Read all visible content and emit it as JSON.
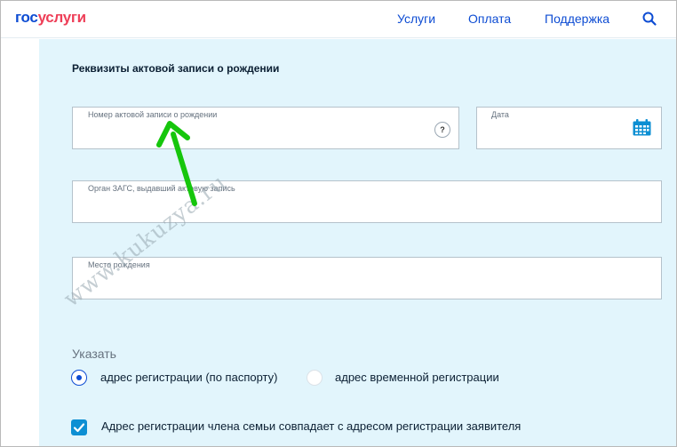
{
  "header": {
    "logo_part1": "гос",
    "logo_part2": "услуги",
    "nav": [
      "Услуги",
      "Оплата",
      "Поддержка"
    ],
    "search_icon": "search-icon"
  },
  "section": {
    "title": "Реквизиты актовой записи о рождении"
  },
  "fields": {
    "record_number": {
      "label": "Номер актовой записи о рождении",
      "value": ""
    },
    "date": {
      "label": "Дата",
      "value": ""
    },
    "registry_office": {
      "label": "Орган ЗАГС, выдавший актовую запись",
      "value": ""
    },
    "birth_place": {
      "label": "Место рождения",
      "value": ""
    }
  },
  "help_icon": {
    "glyph": "?"
  },
  "specify": {
    "label": "Указать",
    "options": [
      {
        "label": "адрес регистрации (по паспорту)",
        "selected": true
      },
      {
        "label": "адрес временной регистрации",
        "selected": false
      }
    ]
  },
  "checkbox": {
    "label": "Адрес регистрации члена семьи совпадает с адресом регистрации заявителя",
    "checked": true
  },
  "watermark": "www.kukuzya.ru",
  "colors": {
    "brand_blue": "#0d4cd3",
    "brand_red": "#ee3f58",
    "panel_bg": "#e2f5fc",
    "checkbox_blue": "#0d8fd3",
    "annotation_arrow": "#16c60c"
  }
}
